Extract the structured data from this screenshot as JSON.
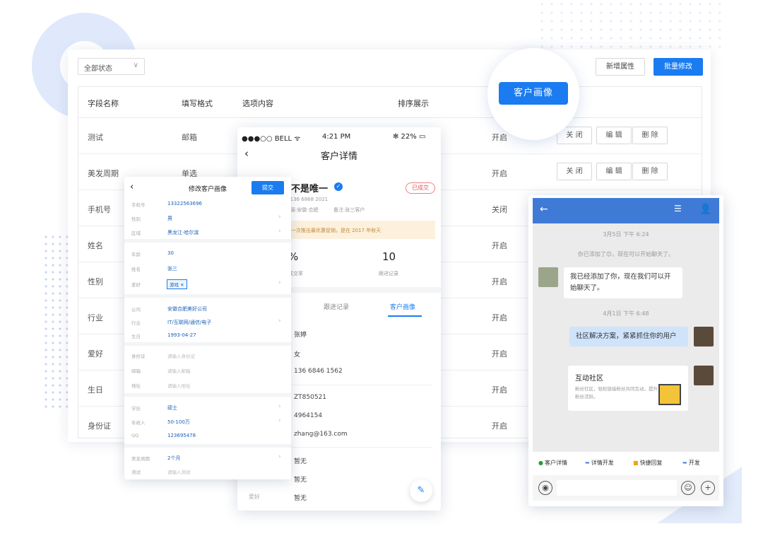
{
  "toolbar": {
    "status_filter": "全部状态",
    "new_attribute": "新增属性",
    "batch_edit": "批量修改"
  },
  "table": {
    "headers": [
      "字段名称",
      "填写格式",
      "选项内容",
      "排序展示"
    ],
    "rows": [
      {
        "name": "测试",
        "format": "邮箱",
        "status": "开启",
        "actions": [
          "关 闭",
          "编 辑",
          "删 除"
        ]
      },
      {
        "name": "美发周期",
        "format": "单选",
        "status": "开启",
        "actions": [
          "关 闭",
          "编 辑",
          "删 除"
        ]
      },
      {
        "name": "手机号",
        "format": "",
        "status": "关闭",
        "actions": []
      },
      {
        "name": "姓名",
        "format": "",
        "status": "开启",
        "actions": []
      },
      {
        "name": "性别",
        "format": "",
        "status": "开启",
        "actions": []
      },
      {
        "name": "行业",
        "format": "",
        "status": "开启",
        "actions": []
      },
      {
        "name": "爱好",
        "format": "",
        "status": "开启",
        "actions": []
      },
      {
        "name": "生日",
        "format": "",
        "status": "开启",
        "actions": []
      },
      {
        "name": "身份证",
        "format": "",
        "status": "开启",
        "actions": []
      }
    ]
  },
  "highlight_button": "客户画像",
  "customer_detail": {
    "status_carrier": "●●●○○ BELL ᯤ",
    "status_time": "4:21 PM",
    "status_battery": "✻ 22% ▭",
    "title": "客户详情",
    "name": "不是唯一",
    "badge": "已成交",
    "phone": "1.136 6868 2021",
    "channel": "来源:安徽·合肥",
    "tag": "备注:张三客户",
    "notice": "一次推出最优惠促销，是在 2017 年秋天",
    "stat1_value": "%",
    "stat1_label": "成交率",
    "stat2_value": "10",
    "stat2_label": "跟进记录",
    "tabs": [
      "跟进记录",
      "客户画像"
    ],
    "fields": [
      "张婷",
      "女",
      "136 6846 1562",
      "ZT850521",
      "4964154",
      "zhang@163.com",
      "暂无",
      "暂无",
      "暂无"
    ],
    "last_label": "爱好"
  },
  "edit_form": {
    "title": "修改客户画像",
    "submit": "提交",
    "fields": [
      {
        "label": "手机号",
        "value": "13322563696"
      },
      {
        "label": "性别",
        "value": "男"
      },
      {
        "label": "区域",
        "value": "黑龙江·哈尔滨"
      },
      {
        "label": "年龄",
        "value": "30"
      },
      {
        "label": "姓名",
        "value": "张三"
      },
      {
        "label": "爱好",
        "value": "游戏"
      },
      {
        "label": "公司",
        "value": "安徽合肥美好公司"
      },
      {
        "label": "行业",
        "value": "IT/互联网/通信/电子"
      },
      {
        "label": "生日",
        "value": "1993-04-27"
      },
      {
        "label": "身份证",
        "placeholder": "请输入身份证"
      },
      {
        "label": "邮箱",
        "placeholder": "请输入邮箱"
      },
      {
        "label": "地址",
        "placeholder": "请输入地址"
      },
      {
        "label": "学历",
        "value": "硕士"
      },
      {
        "label": "年收入",
        "value": "50-100万"
      },
      {
        "label": "QQ",
        "value": "123695478"
      },
      {
        "label": "美发周期",
        "value": "2个月"
      },
      {
        "label": "测试",
        "placeholder": "请输入测试"
      }
    ]
  },
  "chat": {
    "time1": "3月5日 下午 6:24",
    "system": "你已添加了😊，现在可以开始聊天了。",
    "msg1": "我已经添加了你，现在我们可以开始聊天了。",
    "time2": "4月1日 下午 6:48",
    "msg2": "社区解决方案，紧紧抓住你的用户",
    "card_title": "互动社区",
    "card_desc": "粉丝社区，轻松链接粉丝共同互动，提升粉丝活跃。",
    "quick": [
      "客户详情",
      "详情开发",
      "快捷回复",
      "开发"
    ]
  }
}
